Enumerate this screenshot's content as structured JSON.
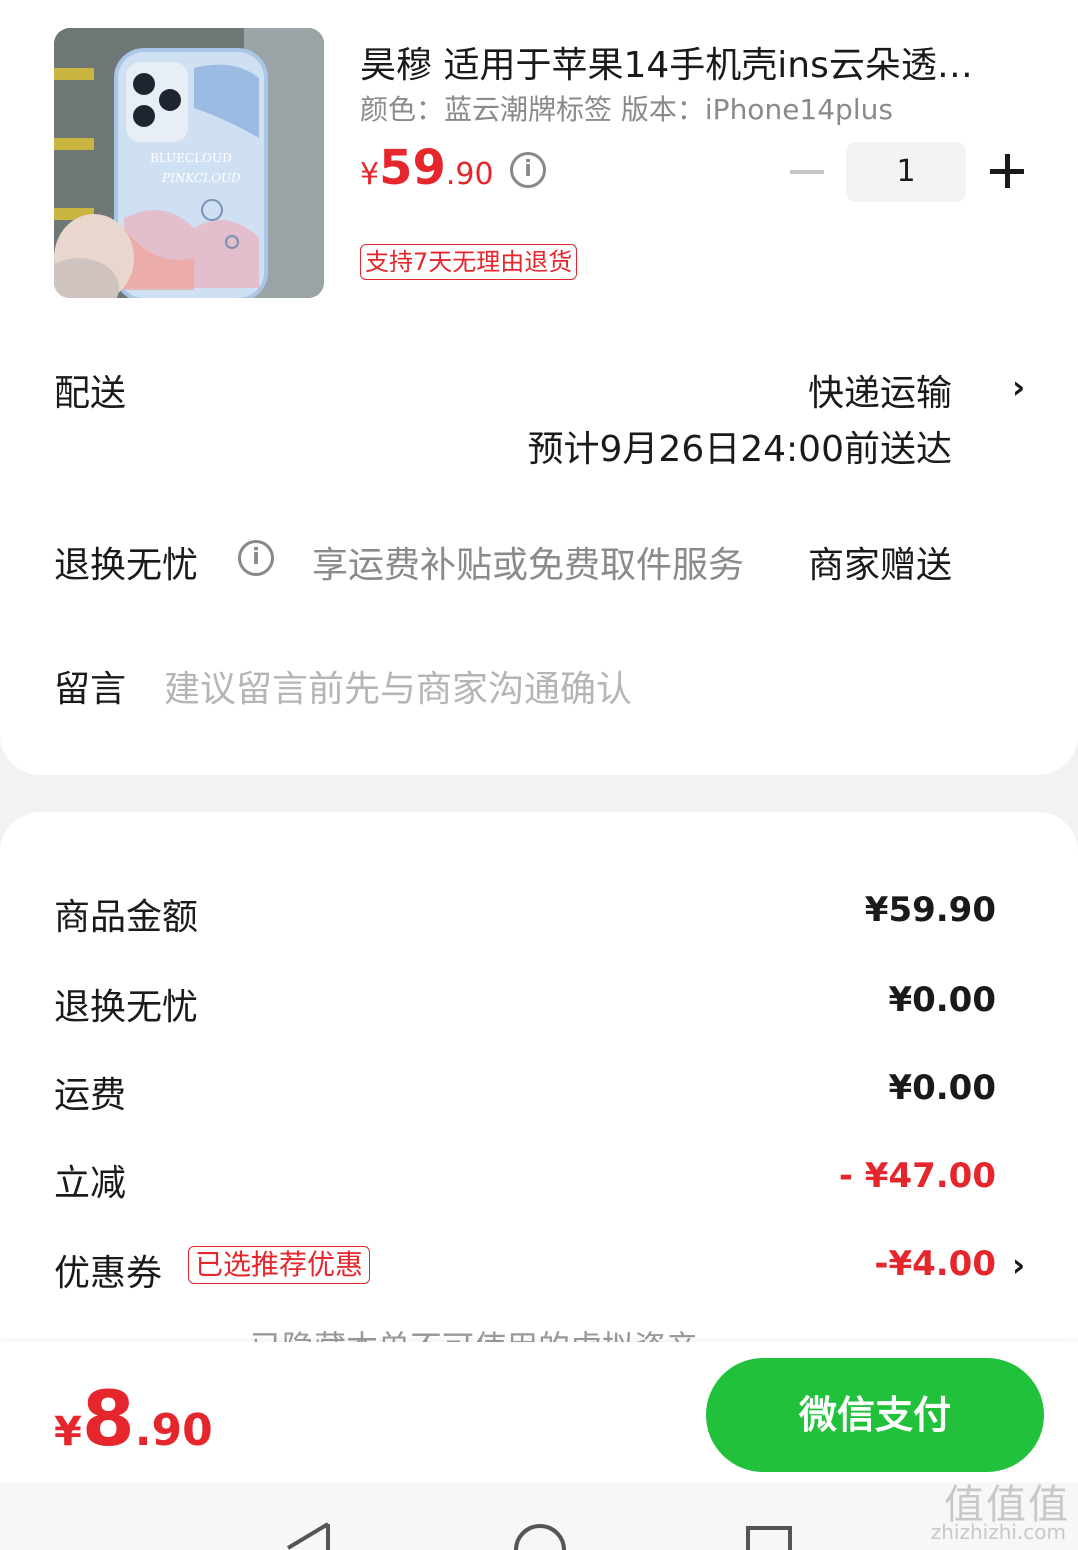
{
  "product": {
    "title": "昊穆 适用于苹果14手机壳ins云朵透…",
    "spec": "颜色：蓝云潮牌标签   版本：iPhone14plus",
    "thumb_icon": "phone-case-photo",
    "thumb_text_1": "BLUECLOUD",
    "thumb_text_2": "PINKCLOUD",
    "price_symbol": "¥",
    "price_int": "59",
    "price_dec": ".90",
    "quantity": "1",
    "return_tag": "支持7天无理由退货"
  },
  "delivery": {
    "label": "配送",
    "method": "快递运输",
    "eta": "预计9月26日24:00前送达"
  },
  "return_worry": {
    "label": "退换无忧",
    "desc": "享运费补贴或免费取件服务",
    "value": "商家赠送"
  },
  "message": {
    "label": "留言",
    "placeholder": "建议留言前先与商家沟通确认"
  },
  "summary": {
    "rows": [
      {
        "label": "商品金额",
        "value": "¥59.90"
      },
      {
        "label": "退换无忧",
        "value": "¥0.00"
      },
      {
        "label": "运费",
        "value": "¥0.00"
      },
      {
        "label": "立减",
        "value": "- ¥47.00"
      },
      {
        "label": "优惠券",
        "value": "-¥4.00"
      }
    ],
    "coupon_tag": "已选推荐优惠",
    "hidden_note": "已隐藏本单不可使用的虚拟资产"
  },
  "footer": {
    "total_symbol": "¥",
    "total_int": "8",
    "total_dec": ".90",
    "pay_button": "微信支付"
  },
  "watermark": {
    "main": "值值值",
    "site": "zhizhizhi.com"
  },
  "colors": {
    "accent_red": "#e5262d",
    "pay_green": "#22c13c"
  }
}
